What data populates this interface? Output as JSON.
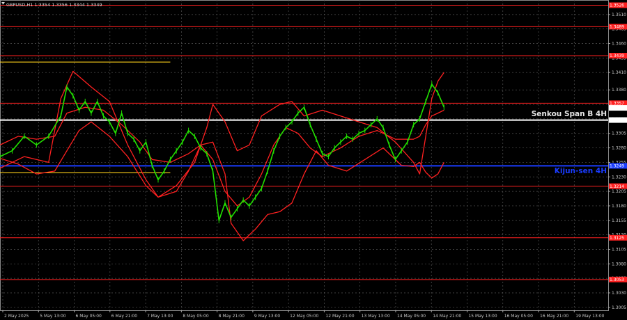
{
  "header": {
    "text": "GBPUSD,H1  1.3354 1.3356 1.3344 1.3349"
  },
  "chart_data": {
    "type": "candlestick",
    "symbol": "GBPUSD",
    "timeframe": "H1",
    "ohlc_readout": {
      "open": 1.3354,
      "high": 1.3356,
      "low": 1.3344,
      "close": 1.3349
    },
    "last_price": 1.3349,
    "ylim": [
      1.3,
      1.3535
    ],
    "y_tick_labels": [
      "1.3005",
      "1.3030",
      "1.3055",
      "1.3080",
      "1.3105",
      "1.3130",
      "1.3155",
      "1.3180",
      "1.3205",
      "1.3230",
      "1.3255",
      "1.3280",
      "1.3305",
      "1.3330",
      "1.3355",
      "1.3380",
      "1.3410",
      "1.3435",
      "1.3460",
      "1.3485",
      "1.3510"
    ],
    "x_tick_labels": [
      "2 May 2025",
      "5 May 13:00",
      "6 May 05:00",
      "6 May 21:00",
      "7 May 13:00",
      "8 May 05:00",
      "8 May 21:00",
      "9 May 13:00",
      "12 May 05:00",
      "12 May 21:00",
      "13 May 13:00",
      "14 May 05:00",
      "14 May 21:00",
      "15 May 13:00",
      "16 May 05:00",
      "16 May 21:00",
      "19 May 13:00"
    ],
    "horizontal_levels": [
      {
        "price": 1.3526,
        "label": "1.3526",
        "color": "#ff2020"
      },
      {
        "price": 1.3489,
        "label": "1.3489",
        "color": "#ff2020"
      },
      {
        "price": 1.3439,
        "label": "1.3439",
        "color": "#ff2020"
      },
      {
        "price": 1.3357,
        "label": "1.3357",
        "color": "#ff2020"
      },
      {
        "price": 1.3328,
        "label": "1.3328",
        "color": "#ffffff"
      },
      {
        "price": 1.3249,
        "label": "1.3249",
        "color": "#1a3cff"
      },
      {
        "price": 1.3214,
        "label": "1.3214",
        "color": "#ff2020"
      },
      {
        "price": 1.3125,
        "label": "1.3125",
        "color": "#ff2020"
      },
      {
        "price": 1.3053,
        "label": "1.3053",
        "color": "#ff2020"
      }
    ],
    "annotations": [
      {
        "text": "Senkou Span B 4H",
        "price": 1.3338,
        "color": "#e6e6e6"
      },
      {
        "text": "Kijun-sen 4H",
        "price": 1.324,
        "color": "#1a3cff"
      }
    ],
    "trend_lines": [
      {
        "color": "#ffd21a",
        "x": [
          0,
          0.28
        ],
        "y": [
          1.3428,
          1.3428
        ]
      },
      {
        "color": "#ffd21a",
        "x": [
          0,
          0.28
        ],
        "y": [
          1.3237,
          1.3237
        ]
      }
    ],
    "series": [
      {
        "role": "ichimoku",
        "color": "#ff2020",
        "x": [
          0,
          0.04,
          0.08,
          0.1,
          0.12,
          0.15,
          0.18,
          0.21,
          0.24,
          0.26,
          0.29,
          0.32,
          0.34,
          0.35,
          0.37,
          0.39,
          0.41,
          0.43,
          0.46,
          0.48,
          0.5,
          0.53,
          0.56,
          0.59,
          0.62,
          0.65,
          0.68,
          0.69,
          0.7,
          0.71,
          0.72,
          0.73
        ],
        "y": [
          1.3245,
          1.3265,
          1.3255,
          1.3365,
          1.3412,
          1.3385,
          1.336,
          1.3285,
          1.3225,
          1.3195,
          1.3215,
          1.3255,
          1.3315,
          1.3355,
          1.3325,
          1.3275,
          1.3285,
          1.3335,
          1.3355,
          1.336,
          1.3335,
          1.3345,
          1.3335,
          1.3325,
          1.3315,
          1.329,
          1.3255,
          1.3235,
          1.33,
          1.3365,
          1.3395,
          1.341
        ]
      },
      {
        "role": "ichimoku",
        "color": "#ff2020",
        "x": [
          0,
          0.03,
          0.06,
          0.09,
          0.11,
          0.14,
          0.17,
          0.2,
          0.23,
          0.25,
          0.28,
          0.31,
          0.33,
          0.35,
          0.37,
          0.39,
          0.41,
          0.43,
          0.45,
          0.47,
          0.49,
          0.51,
          0.53,
          0.56,
          0.59,
          0.62,
          0.65,
          0.68,
          0.69,
          0.7,
          0.71,
          0.72,
          0.73
        ],
        "y": [
          1.3285,
          1.33,
          1.3295,
          1.33,
          1.334,
          1.335,
          1.3345,
          1.332,
          1.329,
          1.326,
          1.3255,
          1.327,
          1.3285,
          1.326,
          1.3205,
          1.318,
          1.3195,
          1.3235,
          1.3285,
          1.3315,
          1.3305,
          1.328,
          1.3265,
          1.328,
          1.33,
          1.331,
          1.3295,
          1.3295,
          1.33,
          1.332,
          1.3335,
          1.334,
          1.3345
        ]
      },
      {
        "role": "ichimoku",
        "color": "#ff2020",
        "x": [
          0,
          0.03,
          0.06,
          0.09,
          0.11,
          0.13,
          0.15,
          0.18,
          0.21,
          0.24,
          0.26,
          0.29,
          0.31,
          0.33,
          0.35,
          0.37,
          0.38,
          0.4,
          0.42,
          0.44,
          0.46,
          0.48,
          0.5,
          0.52,
          0.54,
          0.57,
          0.6,
          0.63,
          0.66,
          0.68,
          0.69,
          0.7,
          0.71,
          0.72,
          0.73
        ],
        "y": [
          1.3262,
          1.3252,
          1.3235,
          1.324,
          1.3275,
          1.331,
          1.3325,
          1.33,
          1.3265,
          1.3215,
          1.3195,
          1.3205,
          1.324,
          1.3285,
          1.329,
          1.3235,
          1.315,
          1.312,
          1.314,
          1.3165,
          1.317,
          1.3185,
          1.3235,
          1.3275,
          1.325,
          1.324,
          1.326,
          1.328,
          1.325,
          1.3248,
          1.3255,
          1.3238,
          1.3228,
          1.3235,
          1.3255
        ]
      },
      {
        "role": "price",
        "color": "#22e000",
        "x": [
          0,
          0.02,
          0.04,
          0.06,
          0.08,
          0.1,
          0.11,
          0.12,
          0.13,
          0.14,
          0.15,
          0.16,
          0.17,
          0.18,
          0.19,
          0.2,
          0.21,
          0.22,
          0.23,
          0.24,
          0.25,
          0.26,
          0.27,
          0.28,
          0.29,
          0.3,
          0.31,
          0.32,
          0.33,
          0.34,
          0.35,
          0.36,
          0.37,
          0.38,
          0.39,
          0.4,
          0.41,
          0.42,
          0.43,
          0.44,
          0.45,
          0.46,
          0.47,
          0.48,
          0.49,
          0.5,
          0.51,
          0.52,
          0.53,
          0.54,
          0.55,
          0.56,
          0.57,
          0.58,
          0.59,
          0.6,
          0.61,
          0.62,
          0.63,
          0.64,
          0.65,
          0.66,
          0.67,
          0.68,
          0.69,
          0.7,
          0.71,
          0.72,
          0.73
        ],
        "y": [
          1.3265,
          1.3275,
          1.33,
          1.3285,
          1.33,
          1.3335,
          1.3385,
          1.337,
          1.3345,
          1.336,
          1.334,
          1.336,
          1.3335,
          1.3325,
          1.3305,
          1.334,
          1.3305,
          1.3295,
          1.3275,
          1.329,
          1.325,
          1.3225,
          1.324,
          1.326,
          1.3275,
          1.329,
          1.331,
          1.33,
          1.328,
          1.327,
          1.324,
          1.3155,
          1.3185,
          1.316,
          1.3175,
          1.319,
          1.318,
          1.3195,
          1.321,
          1.324,
          1.3275,
          1.33,
          1.3315,
          1.3325,
          1.334,
          1.335,
          1.332,
          1.3295,
          1.327,
          1.3265,
          1.328,
          1.329,
          1.33,
          1.3295,
          1.3305,
          1.331,
          1.332,
          1.333,
          1.3315,
          1.3285,
          1.326,
          1.3275,
          1.329,
          1.332,
          1.333,
          1.336,
          1.339,
          1.3375,
          1.335
        ]
      }
    ]
  }
}
